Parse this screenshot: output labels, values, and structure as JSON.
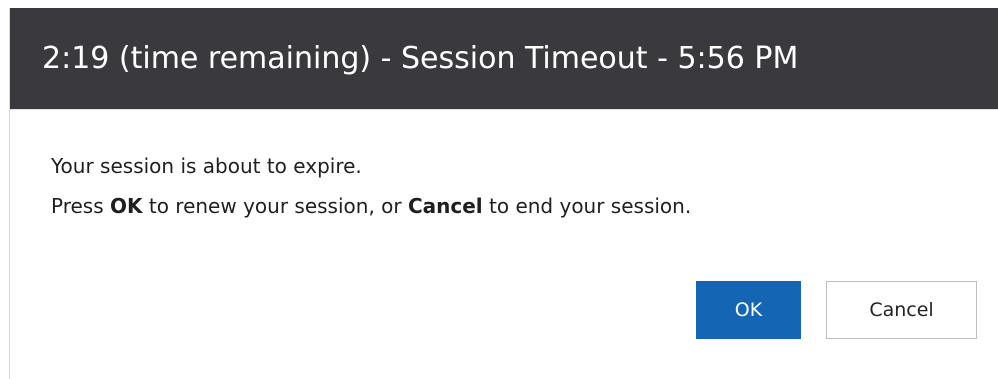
{
  "dialog": {
    "title": "2:19 (time remaining) - Session Timeout - 5:56 PM",
    "message_line1": "Your session is about to expire.",
    "message_line2": {
      "part1": "Press ",
      "ok_word": "OK",
      "part2": " to renew your session, or ",
      "cancel_word": "Cancel",
      "part3": " to end your session."
    },
    "buttons": {
      "ok_label": "OK",
      "cancel_label": "Cancel"
    }
  },
  "colors": {
    "titlebar_bg": "#3a3a3e",
    "primary_button": "#1565b5"
  }
}
